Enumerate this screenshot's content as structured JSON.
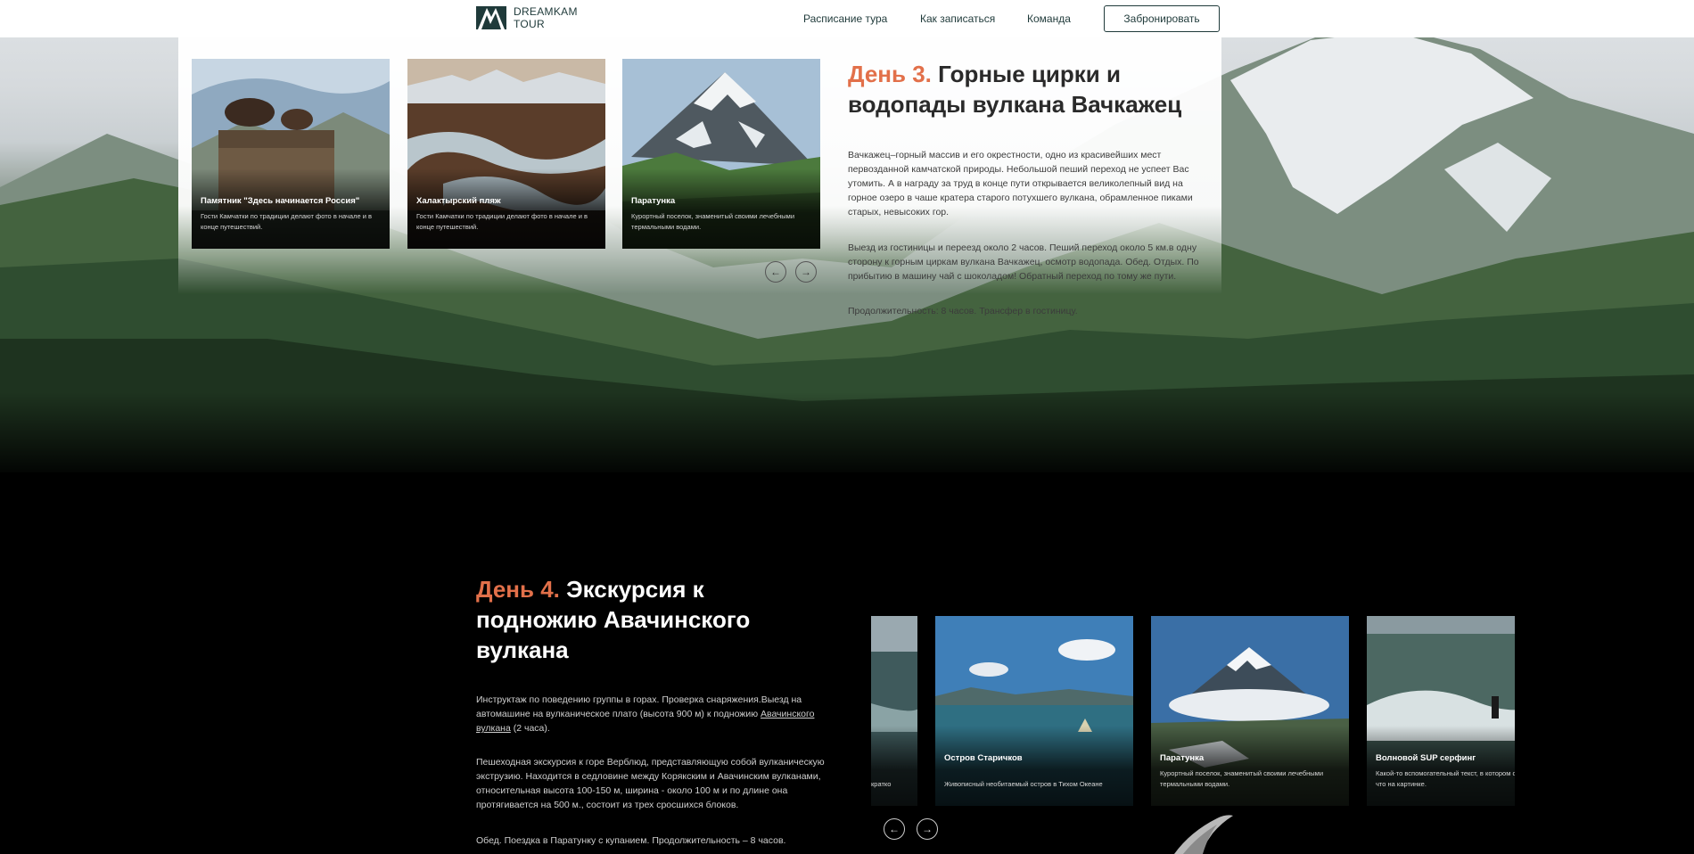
{
  "header": {
    "logo_line1": "DREAMKAM",
    "logo_line2": "TOUR",
    "nav": [
      "Расписание тура",
      "Как записаться",
      "Команда"
    ],
    "book_label": "Забронировать"
  },
  "day3": {
    "day_label": "День 3.",
    "title": "Горные цирки и водопады вулкана Вачкажец",
    "p1": "Вачкажец–горный массив и его окрестности, одно из красивейших мест первозданной камчатской природы. Небольшой пеший переход не успеет Вас утомить. А в награду за труд в конце пути открывается великолепный вид на горное озеро в чаше кратера старого потухшего вулкана, обрамленное пиками старых, невысоких гор.",
    "p2": "Выезд из гостиницы и переезд около 2 часов. Пеший переход около 5 км.в одну сторону к горным циркам вулкана Вачкажец, осмотр водопада. Обед. Отдых. По прибытию в машину чай с шоколадом! Обратный переход по тому же пути.",
    "p3": "Продолжительность: 8 часов. Трансфер в гостиницу.",
    "cards": [
      {
        "title": "Памятник \"Здесь начинается Россия\"",
        "desc": "Гости Камчатки по традиции делают фото в начале и в конце путешествий."
      },
      {
        "title": "Халактырский пляж",
        "desc": "Гости Камчатки по традиции делают фото в начале и в конце путешествий."
      },
      {
        "title": "Паратунка",
        "desc": "Курортный поселок, знаменитый своими лечебными термальными водами."
      }
    ]
  },
  "day4": {
    "day_label": "День 4.",
    "title": "Экскурсия к подножию Авачинского вулкана",
    "p1_a": "Инструктаж по поведению группы в горах. Проверка снаряжения.Выезд на автомашине на вулканическое плато (высота 900 м) к подножию ",
    "p1_link": "Авачинского вулкана",
    "p1_b": " (2 часа).",
    "p2": "Пешеходная экскурсия к горе Верблюд, представляющую собой вулканическую экструзию. Находится в седловине между Корякским и Авачинским вулканами, относительная высота 100-150 м, ширина - около 100 м и по длине она протягивается на 500 м., состоит из трех сросшихся блоков.",
    "p3": "Обед. Поездка в Паратунку с купанием. Продолжительность – 8 часов.",
    "partial_card_desc": "кратко",
    "cards": [
      {
        "title": "Остров Старичков",
        "desc": "Живописный необитаемый остров в Тихом Океане"
      },
      {
        "title": "Паратунка",
        "desc": "Курортный поселок, знаменитый своими лечебными термальными водами."
      },
      {
        "title": "Волновой SUP серфинг",
        "desc": "Какой-то вспомогательный текст, в котором описывается что на картинке."
      }
    ]
  },
  "arrows": {
    "prev": "←",
    "next": "→"
  },
  "colors": {
    "accent": "#e2704a",
    "brand": "#1f3a3a"
  }
}
